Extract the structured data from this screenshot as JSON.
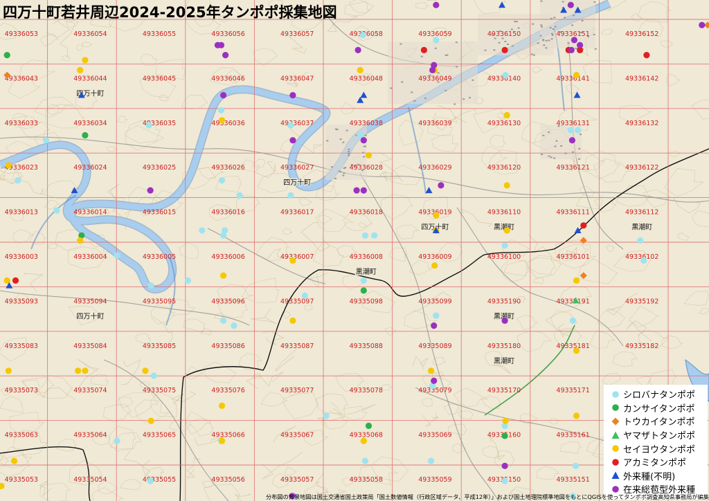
{
  "title": "四万十町若井周辺2024-2025年タンポポ採集地図",
  "colors": {
    "background": "#efe9d6",
    "contour": "#c9b58e",
    "river": "#a9cdee",
    "river_edge": "#5f8fc6",
    "grid": "#e06a6a",
    "grid_label": "#d02020",
    "road": "#8a8a8a",
    "boundary": "#111111"
  },
  "grid": {
    "labels": [
      [
        "49336053",
        "49336054",
        "49336055",
        "49336056",
        "49336057",
        "49336058",
        "49336059",
        "49336150",
        "49336151",
        "49336152"
      ],
      [
        "49336043",
        "49336044",
        "49336045",
        "49336046",
        "49336047",
        "49336048",
        "49336049",
        "49336140",
        "49336141",
        "49336142"
      ],
      [
        "49336033",
        "49336034",
        "49336035",
        "49336036",
        "49336037",
        "49336038",
        "49336039",
        "49336130",
        "49336131",
        "49336132"
      ],
      [
        "49336023",
        "49336024",
        "49336025",
        "49336026",
        "49336027",
        "49336028",
        "49336029",
        "49336120",
        "49336121",
        "49336122"
      ],
      [
        "49336013",
        "49336014",
        "49336015",
        "49336016",
        "49336017",
        "49336018",
        "49336019",
        "49336110",
        "49336111",
        "49336112"
      ],
      [
        "49336003",
        "49336004",
        "49336005",
        "49336006",
        "49336007",
        "49336008",
        "49336009",
        "49336100",
        "49336101",
        "49336102"
      ],
      [
        "49335093",
        "49335094",
        "49335095",
        "49335096",
        "49335097",
        "49335098",
        "49335099",
        "49335190",
        "49335191",
        "49335192"
      ],
      [
        "49335083",
        "49335084",
        "49335085",
        "49335086",
        "49335087",
        "49335088",
        "49335089",
        "49335180",
        "49335181",
        "49335182"
      ],
      [
        "49335073",
        "49335074",
        "49335075",
        "49335076",
        "49335077",
        "49335078",
        "49335079",
        "49335170",
        "49335171",
        "49335172"
      ],
      [
        "49335063",
        "49335064",
        "49335065",
        "49335066",
        "49335067",
        "49335068",
        "49335069",
        "49335160",
        "49335161",
        "49335162"
      ],
      [
        "49335053",
        "49335054",
        "49335055",
        "49335056",
        "49335057",
        "49335058",
        "49335059",
        "49335150",
        "49335151",
        "49335152"
      ]
    ]
  },
  "place_labels": [
    {
      "text": "四万十町",
      "x": 1,
      "y": 1
    },
    {
      "text": "四万十町",
      "x": 1,
      "y": 6
    },
    {
      "text": "四万十町",
      "x": 4,
      "y": 3
    },
    {
      "text": "四万十町",
      "x": 6,
      "y": 4
    },
    {
      "text": "黒潮町",
      "x": 7,
      "y": 4
    },
    {
      "text": "黒潮町",
      "x": 9,
      "y": 4
    },
    {
      "text": "黒潮町",
      "x": 5,
      "y": 5
    },
    {
      "text": "黒潮町",
      "x": 7,
      "y": 6
    },
    {
      "text": "黒潮町",
      "x": 7,
      "y": 7
    }
  ],
  "legend": {
    "items": [
      {
        "label": "シロバナタンポポ",
        "shape": "circle",
        "color": "#9fe3f0"
      },
      {
        "label": "カンサイタンポポ",
        "shape": "circle",
        "color": "#2db04a"
      },
      {
        "label": "トウカイタンポポ",
        "shape": "diamond",
        "color": "#f08020"
      },
      {
        "label": "ヤマザトタンポポ",
        "shape": "triangle",
        "color": "#3cc060"
      },
      {
        "label": "セイヨウタンポポ",
        "shape": "circle",
        "color": "#f5c800"
      },
      {
        "label": "アカミタンポポ",
        "shape": "circle",
        "color": "#e02020"
      },
      {
        "label": "外来種(不明)",
        "shape": "triangle",
        "color": "#2050d0"
      },
      {
        "label": "在来総苞型外来種",
        "shape": "circle",
        "color": "#9b30c0"
      }
    ]
  },
  "points": [
    [
      0.025,
      0.36,
      0
    ],
    [
      0.065,
      0.28,
      0
    ],
    [
      0.115,
      0.47,
      1
    ],
    [
      0.165,
      0.51,
      0
    ],
    [
      0.213,
      0.57,
      0
    ],
    [
      0.313,
      0.36,
      0
    ],
    [
      0.317,
      0.46,
      0
    ],
    [
      0.338,
      0.39,
      0
    ],
    [
      0.21,
      0.25,
      0
    ],
    [
      0.08,
      0.42,
      0
    ],
    [
      0.12,
      0.27,
      1
    ],
    [
      0.165,
      0.88,
      0
    ],
    [
      0.217,
      0.75,
      0
    ],
    [
      0.212,
      0.96,
      0
    ],
    [
      0.265,
      0.56,
      0
    ],
    [
      0.285,
      0.46,
      0
    ],
    [
      0.315,
      0.64,
      0
    ],
    [
      0.33,
      0.65,
      0
    ],
    [
      0.312,
      0.88,
      0
    ],
    [
      0.41,
      0.25,
      0
    ],
    [
      0.41,
      0.39,
      0
    ],
    [
      0.43,
      0.59,
      0
    ],
    [
      0.46,
      0.83,
      0
    ],
    [
      0.515,
      0.47,
      0
    ],
    [
      0.513,
      0.56,
      0
    ],
    [
      0.528,
      0.47,
      0
    ],
    [
      0.61,
      0.77,
      0
    ],
    [
      0.615,
      0.63,
      0
    ],
    [
      0.712,
      0.64,
      0
    ],
    [
      0.712,
      0.49,
      0
    ],
    [
      0.712,
      0.85,
      0
    ],
    [
      0.712,
      0.96,
      0
    ],
    [
      0.512,
      0.07,
      0
    ],
    [
      0.508,
      0.27,
      0
    ],
    [
      0.515,
      0.92,
      0
    ],
    [
      0.608,
      0.92,
      0
    ],
    [
      0.713,
      0.15,
      0
    ],
    [
      0.815,
      0.26,
      0
    ],
    [
      0.805,
      0.26,
      0
    ],
    [
      0.812,
      0.93,
      0
    ],
    [
      0.808,
      0.99,
      0
    ],
    [
      0.808,
      0.64,
      0
    ],
    [
      0.903,
      0.48,
      0
    ],
    [
      0.908,
      0.52,
      0
    ],
    [
      0.615,
      0.08,
      0
    ],
    [
      0.315,
      0.47,
      0
    ],
    [
      0.312,
      0.22,
      0
    ],
    [
      0.415,
      0.99,
      0
    ],
    [
      0.01,
      0.11,
      1
    ],
    [
      0.52,
      0.85,
      1
    ],
    [
      0.513,
      0.58,
      1
    ],
    [
      0.712,
      0.87,
      1
    ],
    [
      0.823,
      0.48,
      2
    ],
    [
      0.823,
      0.55,
      2
    ],
    [
      0.998,
      0.05,
      2
    ],
    [
      0.01,
      0.15,
      2
    ],
    [
      0.812,
      0.6,
      3
    ],
    [
      0.113,
      0.14,
      4
    ],
    [
      0.613,
      0.14,
      4
    ],
    [
      0.713,
      0.84,
      4
    ],
    [
      0.813,
      0.83,
      4
    ],
    [
      0.913,
      0.83,
      4
    ],
    [
      0.813,
      0.7,
      4
    ],
    [
      0.813,
      0.15,
      4
    ],
    [
      0.012,
      0.33,
      4
    ],
    [
      0.12,
      0.12,
      4
    ],
    [
      0.52,
      0.31,
      4
    ],
    [
      0.508,
      0.14,
      4
    ],
    [
      0.413,
      0.64,
      4
    ],
    [
      0.413,
      0.52,
      4
    ],
    [
      0.313,
      0.24,
      4
    ],
    [
      0.313,
      0.81,
      4
    ],
    [
      0.113,
      0.48,
      4
    ],
    [
      0.02,
      0.92,
      4
    ],
    [
      0.002,
      0.97,
      4
    ],
    [
      0.313,
      0.88,
      4
    ],
    [
      0.315,
      0.55,
      4
    ],
    [
      0.01,
      0.56,
      4
    ],
    [
      0.12,
      0.74,
      4
    ],
    [
      0.715,
      0.46,
      4
    ],
    [
      0.615,
      0.43,
      4
    ],
    [
      0.715,
      0.37,
      4
    ],
    [
      0.615,
      0.46,
      4
    ],
    [
      0.813,
      0.56,
      4
    ],
    [
      0.513,
      0.88,
      4
    ],
    [
      0.613,
      0.53,
      4
    ],
    [
      0.608,
      0.74,
      4
    ],
    [
      0.715,
      0.23,
      4
    ],
    [
      0.213,
      0.84,
      4
    ],
    [
      0.012,
      0.74,
      4
    ],
    [
      0.11,
      0.74,
      4
    ],
    [
      0.205,
      0.74,
      4
    ],
    [
      0.598,
      0.1,
      5
    ],
    [
      0.022,
      0.56,
      5
    ],
    [
      0.818,
      0.1,
      5
    ],
    [
      0.912,
      0.11,
      5
    ],
    [
      0.823,
      0.45,
      5
    ],
    [
      0.712,
      0.1,
      5
    ],
    [
      0.802,
      0.1,
      5
    ],
    [
      0.105,
      0.38,
      6
    ],
    [
      0.115,
      0.19,
      6
    ],
    [
      0.508,
      0.2,
      6
    ],
    [
      0.605,
      0.38,
      6
    ],
    [
      0.615,
      0.46,
      6
    ],
    [
      0.708,
      0.01,
      6
    ],
    [
      0.795,
      0.02,
      6
    ],
    [
      0.815,
      0.46,
      6
    ],
    [
      0.013,
      0.57,
      6
    ],
    [
      0.815,
      0.02,
      6
    ],
    [
      0.513,
      0.19,
      6
    ],
    [
      0.814,
      0.19,
      6
    ],
    [
      0.413,
      0.19,
      7
    ],
    [
      0.413,
      0.28,
      7
    ],
    [
      0.505,
      0.1,
      7
    ],
    [
      0.503,
      0.38,
      7
    ],
    [
      0.307,
      0.09,
      7
    ],
    [
      0.318,
      0.11,
      7
    ],
    [
      0.412,
      0.99,
      7
    ],
    [
      0.612,
      0.13,
      7
    ],
    [
      0.712,
      0.64,
      7
    ],
    [
      0.612,
      0.76,
      7
    ],
    [
      0.712,
      0.93,
      7
    ],
    [
      0.807,
      0.28,
      7
    ],
    [
      0.818,
      0.09,
      7
    ],
    [
      0.81,
      0.08,
      7
    ],
    [
      0.805,
      0.01,
      7
    ],
    [
      0.61,
      0.14,
      7
    ],
    [
      0.315,
      0.19,
      7
    ],
    [
      0.622,
      0.37,
      7
    ],
    [
      0.615,
      0.01,
      7
    ],
    [
      0.513,
      0.28,
      7
    ],
    [
      0.612,
      0.65,
      7
    ],
    [
      0.513,
      0.38,
      7
    ],
    [
      0.212,
      0.38,
      7
    ],
    [
      0.312,
      0.09,
      7
    ],
    [
      0.806,
      0.1,
      7
    ],
    [
      0.99,
      0.05,
      7
    ]
  ],
  "credit": "分布図の背景地図は国土交通省国土政策局「国土数値情報（行政区域データ、平成12年）」および国土地理院標準地図をもとにQGISを使ってタンポポ調査高知県事務局が編集・加工"
}
